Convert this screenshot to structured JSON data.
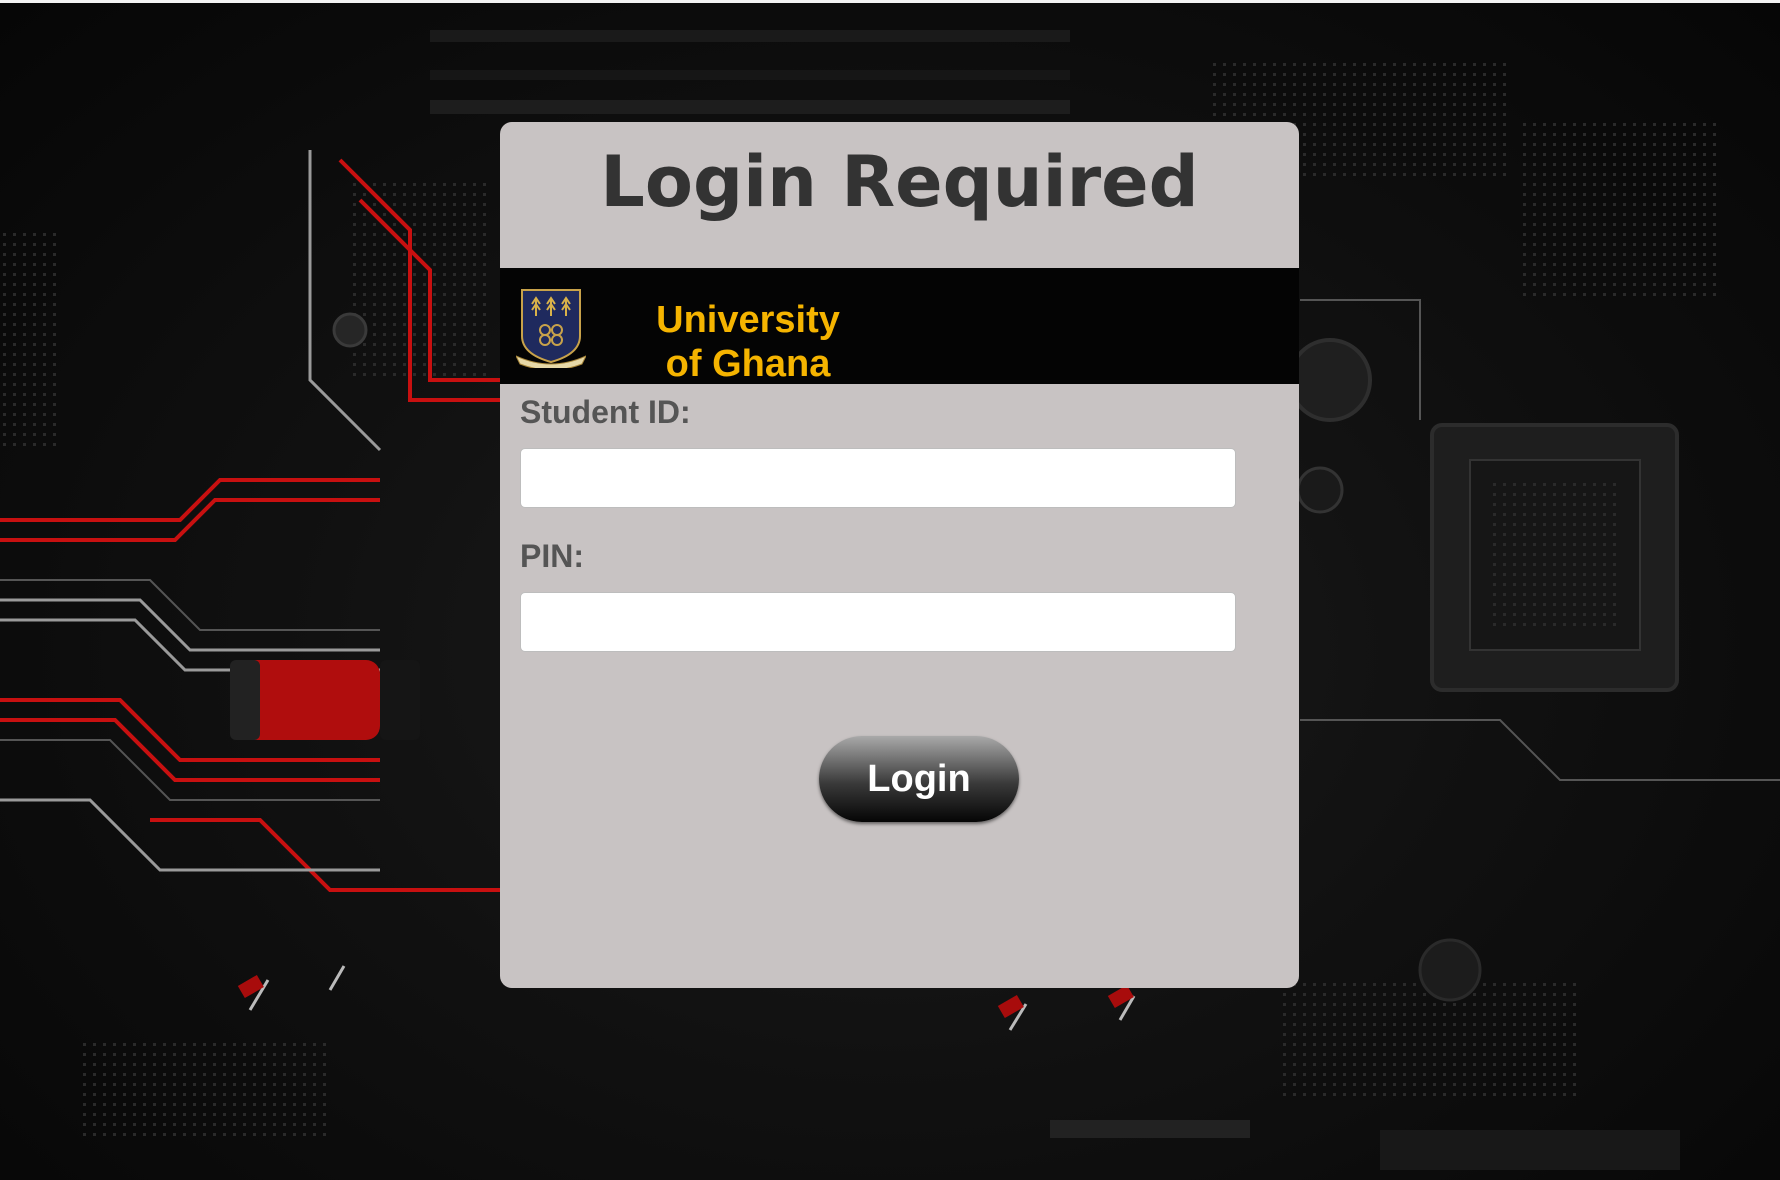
{
  "colors": {
    "card_background": "#c8c3c3",
    "brand_bar": "#040404",
    "brand_text": "#f5b400",
    "title_text": "#333333",
    "label_text": "#555555",
    "circuit_accent": "#d01010"
  },
  "login": {
    "title": "Login Required",
    "brand": {
      "line1": "University",
      "line2": "of Ghana",
      "logo_icon": "university-crest-icon"
    },
    "student_id": {
      "label": "Student ID:",
      "value": "",
      "placeholder": ""
    },
    "pin": {
      "label": "PIN:",
      "value": "",
      "placeholder": ""
    },
    "submit_label": "Login"
  },
  "background": {
    "image": "circuit-board-background"
  }
}
